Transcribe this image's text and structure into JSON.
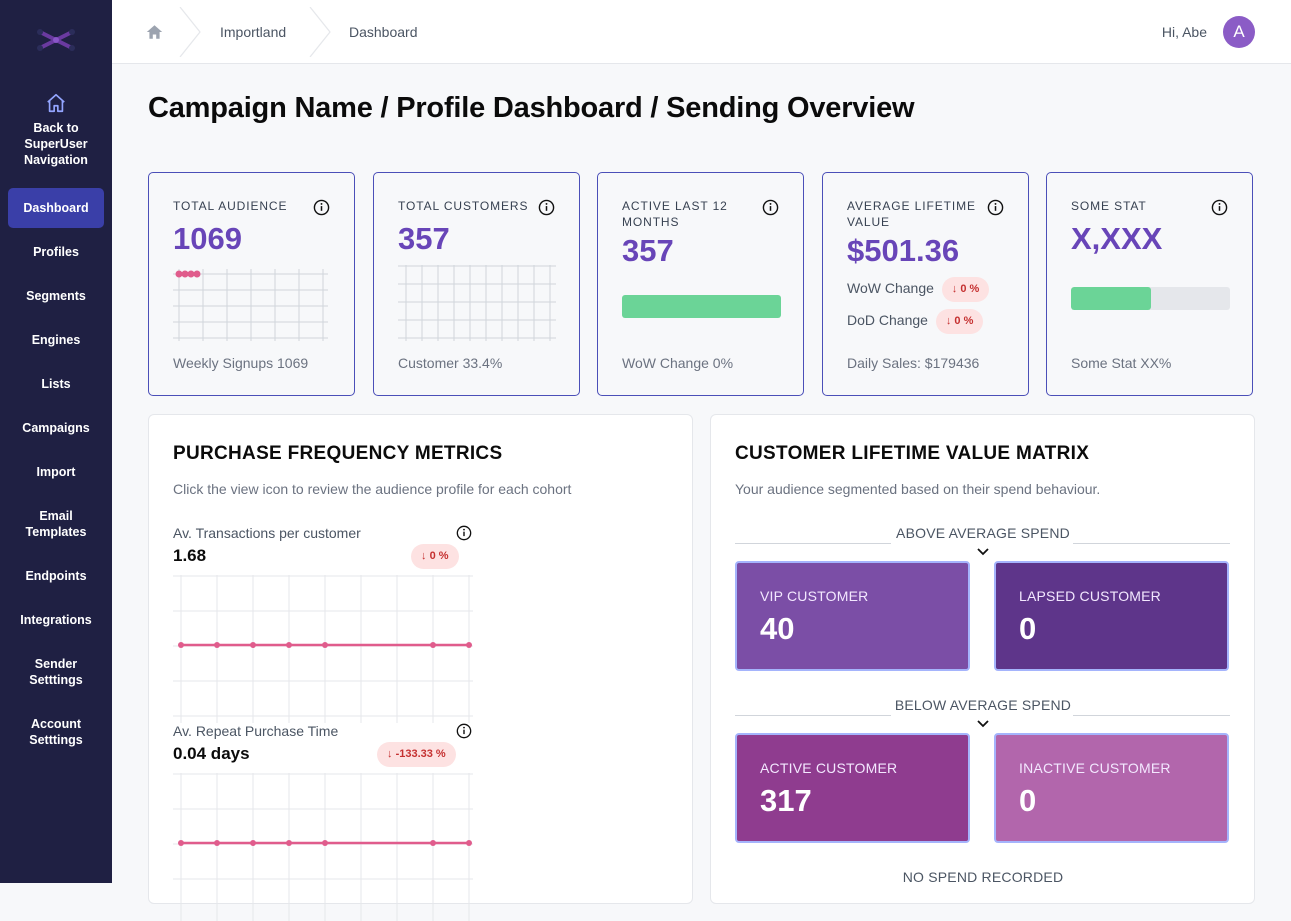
{
  "sidebar": {
    "home_label_lines": [
      "Back to",
      "SuperUser",
      "Navigation"
    ],
    "items": [
      {
        "label": "Dashboard",
        "active": true
      },
      {
        "label": "Profiles"
      },
      {
        "label": "Segments"
      },
      {
        "label": "Engines"
      },
      {
        "label": "Lists"
      },
      {
        "label": "Campaigns"
      },
      {
        "label": "Import"
      },
      {
        "label": "Email Templates"
      },
      {
        "label": "Endpoints"
      },
      {
        "label": "Integrations"
      },
      {
        "label": "Sender Setttings"
      },
      {
        "label": "Account Setttings"
      }
    ]
  },
  "topbar": {
    "breadcrumb": [
      "Importland",
      "Dashboard"
    ],
    "greeting": "Hi, Abe",
    "avatar_initial": "A"
  },
  "page_title": "Campaign Name / Profile Dashboard / Sending Overview",
  "stats": {
    "total_audience": {
      "label": "TOTAL AUDIENCE",
      "value": "1069",
      "footer": "Weekly Signups 1069"
    },
    "total_customers": {
      "label": "TOTAL CUSTOMERS",
      "value": "357",
      "footer": "Customer 33.4%"
    },
    "active_12m": {
      "label": "ACTIVE LAST 12 MONTHS",
      "value": "357",
      "footer": "WoW Change 0%",
      "bar_fraction": 1.0
    },
    "avg_ltv": {
      "label": "AVERAGE LIFETIME VALUE",
      "value": "$501.36",
      "wow_label": "WoW Change",
      "wow_pill": "0 %",
      "dod_label": "DoD Change",
      "dod_pill": "0 %",
      "footer": "Daily Sales: $179436"
    },
    "some_stat": {
      "label": "SOME STAT",
      "value": "X,XXX",
      "footer": "Some Stat XX%",
      "bar_fraction": 0.5
    }
  },
  "purchase_panel": {
    "title": "PURCHASE FREQUENCY METRICS",
    "subtitle": "Click the view icon to review the audience profile for each cohort",
    "metrics": [
      {
        "name": "Av. Transactions per customer",
        "value": "1.68",
        "pill": "0 %"
      },
      {
        "name": "Av. Repeat Purchase Time",
        "value": "0.04 days",
        "pill": "-133.33 %"
      }
    ]
  },
  "clv_panel": {
    "title": "CUSTOMER LIFETIME VALUE MATRIX",
    "subtitle": "Your audience segmented based on their spend behaviour.",
    "above_label": "ABOVE AVERAGE SPEND",
    "below_label": "BELOW AVERAGE SPEND",
    "none_label": "NO SPEND RECORDED",
    "segments": [
      {
        "name": "VIP CUSTOMER",
        "value": "40",
        "color": "#7b4ea6"
      },
      {
        "name": "LAPSED CUSTOMER",
        "value": "0",
        "color": "#5e358a"
      },
      {
        "name": "ACTIVE CUSTOMER",
        "value": "317",
        "color": "#8f3c8f"
      },
      {
        "name": "INACTIVE CUSTOMER",
        "value": "0",
        "color": "#b266ac"
      }
    ]
  },
  "colors": {
    "sidebar_bg": "#1f2043",
    "accent": "#6845b8",
    "active_nav": "#3a3fa8",
    "bar_green": "#6bd497",
    "line_pink": "#e05c8c",
    "pill_bg": "#fde2e2",
    "pill_text": "#c53030"
  }
}
